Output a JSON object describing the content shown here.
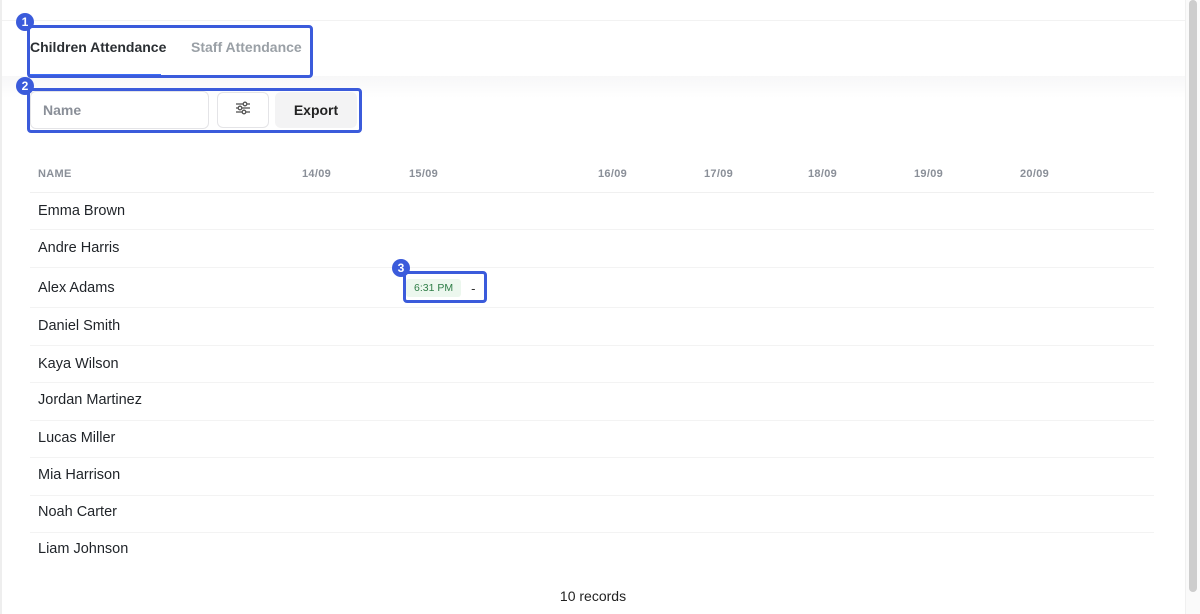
{
  "tabs": [
    {
      "label": "Children Attendance",
      "active": true
    },
    {
      "label": "Staff Attendance",
      "active": false
    }
  ],
  "toolbar": {
    "name_placeholder": "Name",
    "name_value": "",
    "filter_icon": "sliders-icon",
    "export_label": "Export"
  },
  "table": {
    "columns": [
      "NAME",
      "14/09",
      "15/09",
      "16/09",
      "17/09",
      "18/09",
      "19/09",
      "20/09"
    ],
    "rows": [
      {
        "name": "Emma Brown"
      },
      {
        "name": "Andre Harris"
      },
      {
        "name": "Alex Adams",
        "attendance": {
          "date": "15/09",
          "check_in": "6:31 PM",
          "check_out": "-"
        }
      },
      {
        "name": "Daniel Smith"
      },
      {
        "name": "Kaya Wilson"
      },
      {
        "name": "Jordan Martinez"
      },
      {
        "name": "Lucas Miller"
      },
      {
        "name": "Mia Harrison"
      },
      {
        "name": "Noah Carter"
      },
      {
        "name": "Liam Johnson"
      }
    ]
  },
  "footer": {
    "records": "10 records"
  },
  "annotations": [
    "1",
    "2",
    "3"
  ],
  "colors": {
    "accent": "#3b6cf6",
    "annotation": "#3b5bdb",
    "checkin_bg": "#ecf7ee",
    "checkin_text": "#2e7d46"
  }
}
